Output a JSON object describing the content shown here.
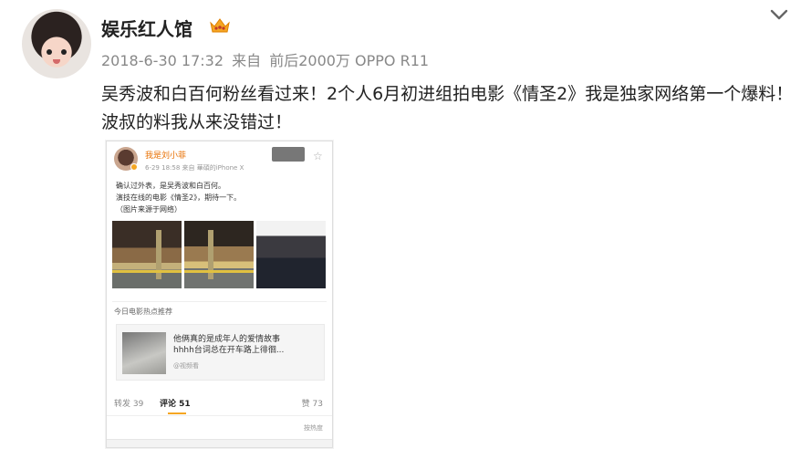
{
  "post": {
    "username": "娱乐红人馆",
    "time": "2018-6-30 17:32",
    "source_prefix": "来自",
    "source": "前后2000万 OPPO R11",
    "text": "吴秀波和白百何粉丝看过来！2个人6月初进组拍电影《情圣2》我是独家网络第一个爆料！波叔的料我从来没错过！"
  },
  "embedded_card": {
    "name": "我是刘小菲",
    "meta": "6-29 18:58  来自 華碩的iPhone X",
    "lines": [
      "确认过外表，是吴秀波和白百何。",
      "演技在线的电影《情圣2》，期待一下。",
      "（图片来源于网络）"
    ],
    "section": "今日电影热点推荐",
    "rec_title_1": "他俩真的是成年人的爱情故事",
    "rec_title_2": "hhhh台词总在开车路上徘徊...",
    "rec_source": "@视频看",
    "repost": "转发 39",
    "comment": "评论 51",
    "like": "赞 73",
    "sort": "按热度"
  },
  "colors": {
    "name_accent": "#e86f00",
    "tab_underline": "#f5a623"
  }
}
